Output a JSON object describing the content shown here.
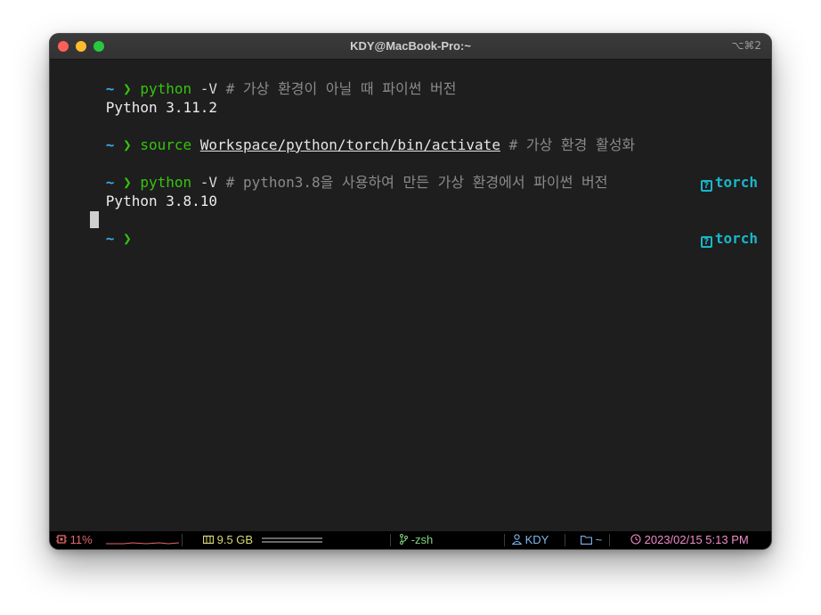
{
  "window": {
    "title": "KDY@MacBook-Pro:~",
    "shortcut": "⌥⌘2"
  },
  "colors": {
    "prompt_dir": "#3fa9e0",
    "prompt_arrow": "#35c40f",
    "command": "#35c40f",
    "comment": "#8a8a8a",
    "venv": "#18b7c9",
    "terminal_bg": "#1e1e1e"
  },
  "terminal": {
    "prompt_dir": "~",
    "prompt_arrow": "❯",
    "lines": [
      {
        "cmd": "python",
        "args": " -V",
        "comment": " # 가상 환경이 아닐 때 파이썬 버전"
      },
      {
        "output": "Python 3.11.2"
      },
      {
        "cmd": "source",
        "path": "Workspace/python/torch/bin/activate",
        "comment": " # 가상 환경 활성화"
      },
      {
        "cmd": "python",
        "args": " -V",
        "comment": " # python3.8을 사용하여 만든 가상 환경에서 파이썬 버전",
        "venv": "torch"
      },
      {
        "output": "Python 3.8.10"
      },
      {
        "venv": "torch"
      }
    ],
    "venv_icon": "?"
  },
  "statusbar": {
    "cpu": "11%",
    "cpu_icon": "cpu-icon",
    "memory": "9.5 GB",
    "memory_icon": "memory-icon",
    "shell": "-zsh",
    "shell_icon": "git-branch-icon",
    "user": "KDY",
    "user_icon": "user-icon",
    "dir": "~",
    "dir_icon": "folder-icon",
    "datetime": "2023/02/15 5:13 PM",
    "clock_icon": "clock-icon"
  }
}
